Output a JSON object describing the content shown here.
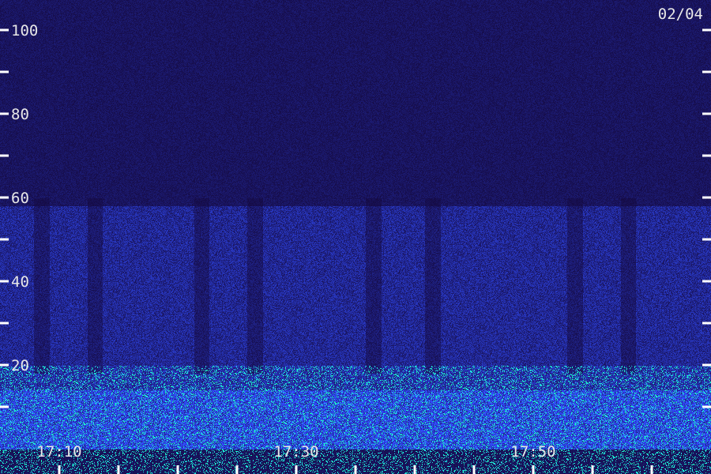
{
  "chart_data": {
    "type": "heatmap",
    "title": "",
    "date_label": "02/04",
    "xlabel": "",
    "ylabel": "",
    "ylim": [
      0,
      100
    ],
    "y_tick_labels": [
      "20",
      "40",
      "60",
      "80",
      "100"
    ],
    "y_minor_ticks": [
      10,
      30,
      50,
      70,
      90
    ],
    "x_tick_labels": [
      "17:10",
      "17:30",
      "17:50"
    ],
    "x_range_minutes": [
      17.0,
      17.0
    ],
    "time_start": "17:05",
    "time_end": "18:05",
    "time_ticks_minor_every_min": 5,
    "time_labels": [
      {
        "time": "17:10",
        "minute": 10
      },
      {
        "time": "17:30",
        "minute": 30
      },
      {
        "time": "17:50",
        "minute": 50
      }
    ],
    "intensity_bands": [
      {
        "y_from": 0,
        "y_to": 14,
        "level": 0.95
      },
      {
        "y_from": 14,
        "y_to": 20,
        "level": 0.6
      },
      {
        "y_from": 20,
        "y_to": 58,
        "level": 0.45
      },
      {
        "y_from": 58,
        "y_to": 100,
        "level": 0.18
      }
    ],
    "dark_columns_minute": [
      8.5,
      13.0,
      22.0,
      26.5,
      36.5,
      41.5,
      53.5,
      58.0
    ],
    "colors": {
      "background": "#14084a",
      "low": "#1a0a5c",
      "mid": "#2a3ad8",
      "high": "#1ec8d8",
      "axis": "#ffffff"
    }
  }
}
